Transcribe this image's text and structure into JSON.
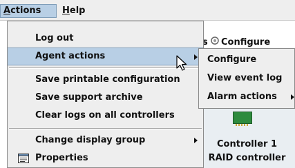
{
  "menubar": {
    "items": [
      {
        "label": "Actions",
        "mnemonic": "A",
        "rest": "ctions"
      },
      {
        "label": "Help",
        "mnemonic": "H",
        "rest": "elp"
      }
    ]
  },
  "background": {
    "toolbar_partial_text": "s",
    "toolbar_configure": "Configure",
    "controller_line1": "Controller 1",
    "controller_line2": "RAID controller"
  },
  "actions_menu": {
    "items": [
      {
        "label": "Log out"
      },
      {
        "label": "Agent actions",
        "selected": true,
        "submenu": true
      },
      {
        "label": "Save printable configuration"
      },
      {
        "label": "Save support archive"
      },
      {
        "label": "Clear logs on all controllers"
      },
      {
        "label": "Change display group",
        "submenu": true
      },
      {
        "label": "Properties",
        "icon": "properties-icon"
      }
    ]
  },
  "agent_actions_submenu": {
    "items": [
      {
        "label": "Configure"
      },
      {
        "label": "View event log"
      },
      {
        "label": "Alarm actions",
        "submenu": true
      }
    ]
  },
  "colors": {
    "menu_bg": "#eeeeee",
    "selection_bg": "#b8cfe5",
    "selection_border": "#7f9db9"
  }
}
